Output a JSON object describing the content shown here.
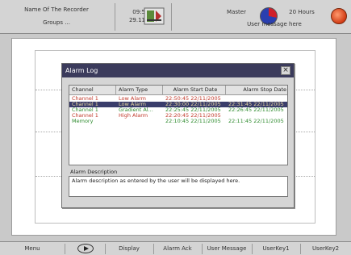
{
  "topbar": {
    "recorder_name": "Name Of The Recorder",
    "groups": "Groups ...",
    "time": "09:53:13",
    "date": "29.11.2005",
    "user_level": "Master",
    "hours": "20 Hours",
    "user_message": "User message here"
  },
  "dialog": {
    "title": "Alarm Log",
    "close_glyph": "×",
    "columns": [
      "Channel",
      "Alarm Type",
      "Alarm Start Date",
      "Alarm Stop Date"
    ],
    "rows": [
      {
        "channel": "Channel 1",
        "type": "Low Alarm",
        "start": "22:50:45 22/11/2005",
        "stop": "",
        "color": "#c0392b",
        "selected": false
      },
      {
        "channel": "Channel 1",
        "type": "Low Alarm",
        "start": "22:30:00 22/11/2005",
        "stop": "22:31:45 22/11/2005",
        "color": "#e8d8a0",
        "selected": true
      },
      {
        "channel": "Channel 1",
        "type": "Gradient Al...",
        "start": "22:25:45 22/11/2005",
        "stop": "22:26:45 22/11/2005",
        "color": "#2e8b2e",
        "selected": false
      },
      {
        "channel": "Channel 1",
        "type": "High Alarm",
        "start": "22:20:45 22/11/2005",
        "stop": "",
        "color": "#c0392b",
        "selected": false
      },
      {
        "channel": "Memory",
        "type": "",
        "start": "22:10:45 22/11/2005",
        "stop": "22:11:45 22/11/2005",
        "color": "#2e8b2e",
        "selected": false
      }
    ],
    "description_label": "Alarm Description",
    "description_text": "Alarm description as entered by the user will be displayed here."
  },
  "softkeys": {
    "menu": "Menu",
    "display": "Display",
    "alarm_ack": "Alarm Ack",
    "user_message": "User Message",
    "userkey1": "UserKey1",
    "userkey2": "UserKey2"
  },
  "icons": {
    "recorder": "recorder-icon",
    "storage": "storage-pie-icon",
    "alarm": "alarm-indicator-icon",
    "play": "play-icon"
  }
}
